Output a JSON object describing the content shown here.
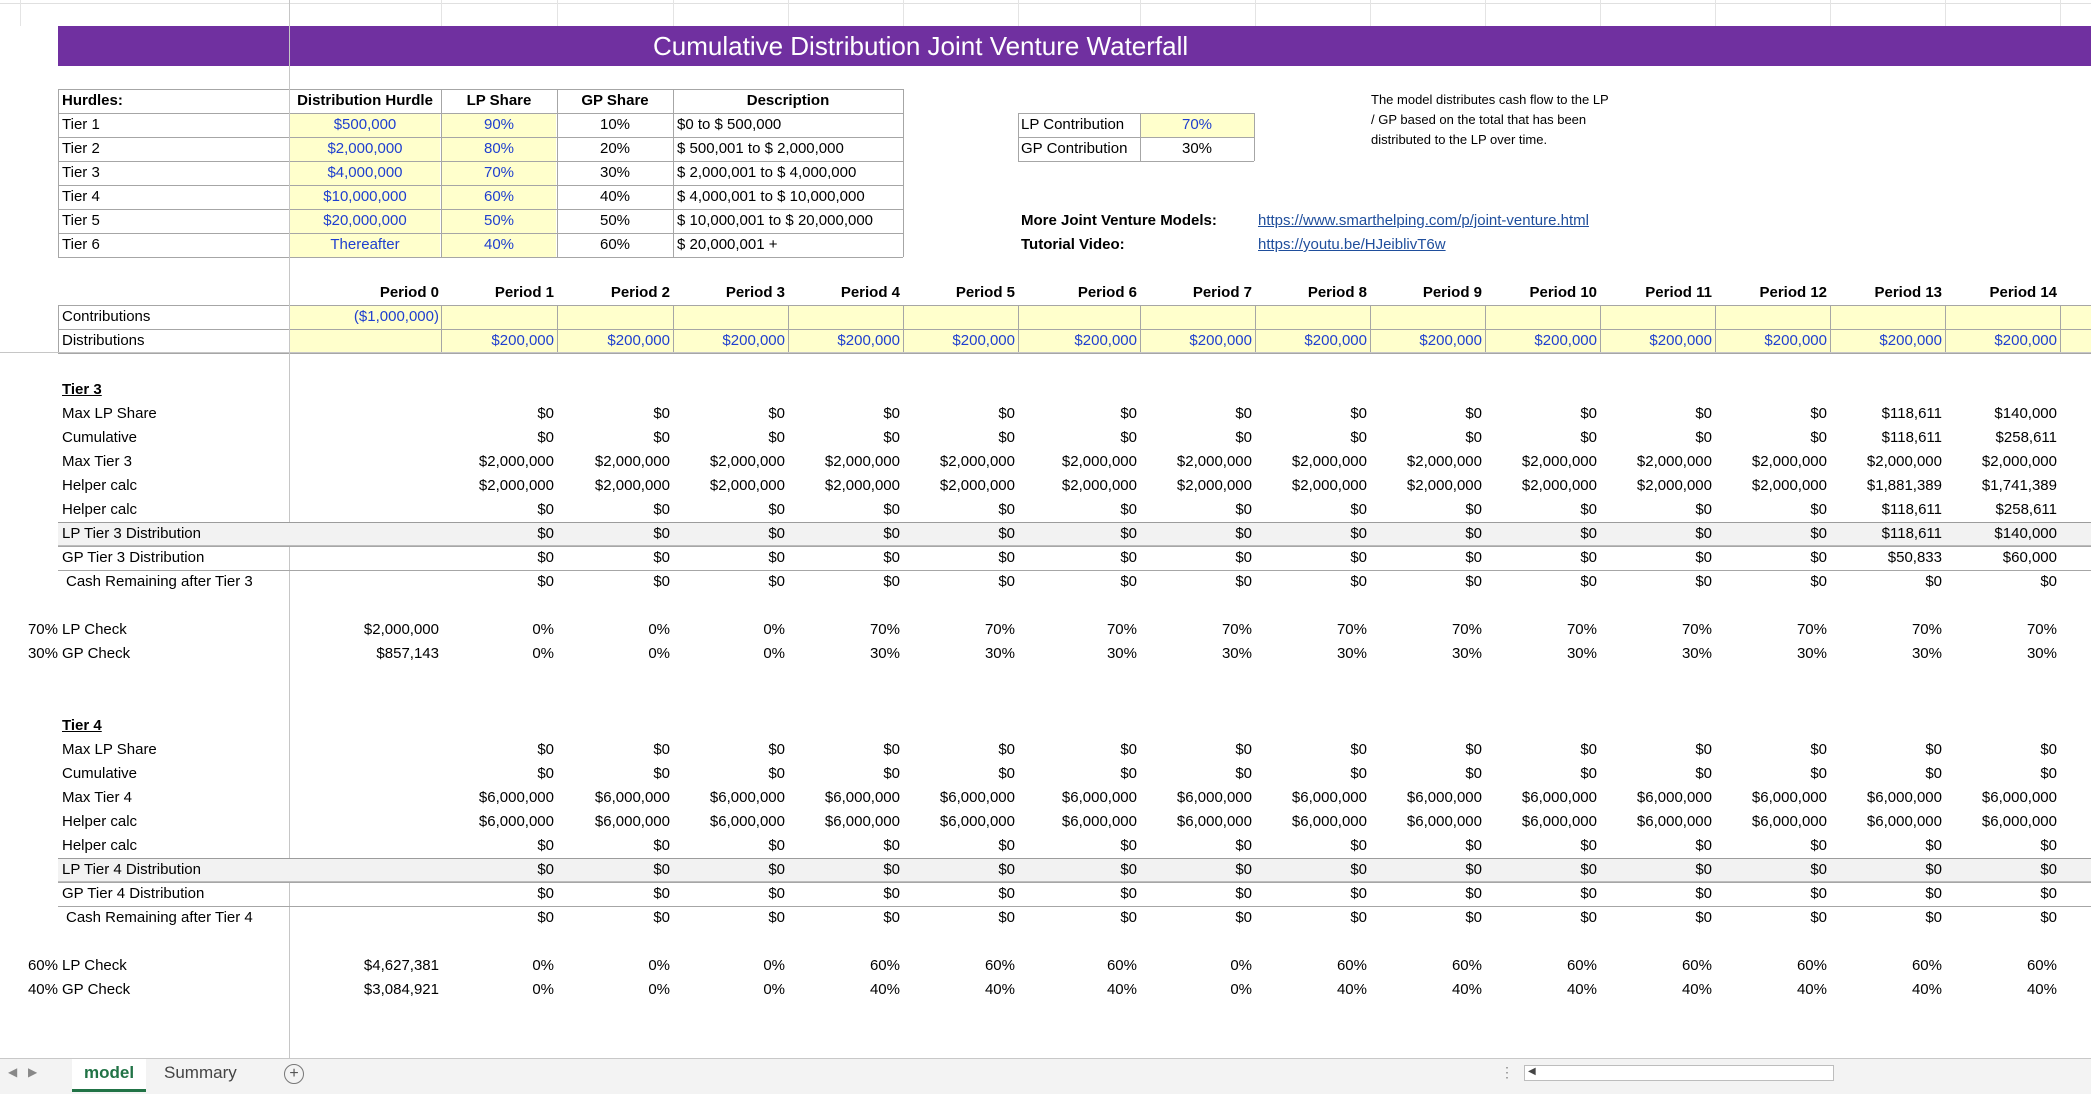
{
  "title": "Cumulative Distribution Joint Venture Waterfall",
  "hurdles": {
    "headers": [
      "Hurdles:",
      "Distribution Hurdle",
      "LP Share",
      "GP Share",
      "Description"
    ],
    "rows": [
      {
        "tier": "Tier 1",
        "hurdle": "$500,000",
        "lp": "90%",
        "gp": "10%",
        "desc": "$0 to $ 500,000"
      },
      {
        "tier": "Tier 2",
        "hurdle": "$2,000,000",
        "lp": "80%",
        "gp": "20%",
        "desc": "$ 500,001 to $ 2,000,000"
      },
      {
        "tier": "Tier 3",
        "hurdle": "$4,000,000",
        "lp": "70%",
        "gp": "30%",
        "desc": "$ 2,000,001 to $ 4,000,000"
      },
      {
        "tier": "Tier 4",
        "hurdle": "$10,000,000",
        "lp": "60%",
        "gp": "40%",
        "desc": "$ 4,000,001 to $ 10,000,000"
      },
      {
        "tier": "Tier 5",
        "hurdle": "$20,000,000",
        "lp": "50%",
        "gp": "50%",
        "desc": "$ 10,000,001 to $ 20,000,000"
      },
      {
        "tier": "Tier 6",
        "hurdle": "Thereafter",
        "lp": "40%",
        "gp": "60%",
        "desc": "$ 20,000,001 +"
      }
    ]
  },
  "contributions_box": [
    {
      "label": "LP Contribution",
      "value": "70%"
    },
    {
      "label": "GP Contribution",
      "value": "30%"
    }
  ],
  "note": "The model distributes cash flow to the LP / GP based on the total that has been distributed to the LP over time.",
  "links": [
    {
      "label": "More Joint Venture Models:",
      "url": "https://www.smarthelping.com/p/joint-venture.html"
    },
    {
      "label": "Tutorial Video:",
      "url": "https://youtu.be/HJeiblivT6w"
    }
  ],
  "periods": [
    "Period 0",
    "Period 1",
    "Period 2",
    "Period 3",
    "Period 4",
    "Period 5",
    "Period 6",
    "Period 7",
    "Period 8",
    "Period 9",
    "Period 10",
    "Period 11",
    "Period 12",
    "Period 13",
    "Period 14"
  ],
  "cashflows": {
    "contributions_label": "Contributions",
    "contributions_p0": "($1,000,000)",
    "distributions_label": "Distributions",
    "distributions": [
      "$200,000",
      "$200,000",
      "$200,000",
      "$200,000",
      "$200,000",
      "$200,000",
      "$200,000",
      "$200,000",
      "$200,000",
      "$200,000",
      "$200,000",
      "$200,000",
      "$200,000",
      "$200,000"
    ]
  },
  "tier3": {
    "header": "Tier 3",
    "rows": [
      {
        "label": "Max LP Share",
        "values": [
          "$0",
          "$0",
          "$0",
          "$0",
          "$0",
          "$0",
          "$0",
          "$0",
          "$0",
          "$0",
          "$0",
          "$0",
          "$118,611",
          "$140,000"
        ]
      },
      {
        "label": "Cumulative",
        "values": [
          "$0",
          "$0",
          "$0",
          "$0",
          "$0",
          "$0",
          "$0",
          "$0",
          "$0",
          "$0",
          "$0",
          "$0",
          "$118,611",
          "$258,611"
        ]
      },
      {
        "label": "Max Tier 3",
        "values": [
          "$2,000,000",
          "$2,000,000",
          "$2,000,000",
          "$2,000,000",
          "$2,000,000",
          "$2,000,000",
          "$2,000,000",
          "$2,000,000",
          "$2,000,000",
          "$2,000,000",
          "$2,000,000",
          "$2,000,000",
          "$2,000,000",
          "$2,000,000"
        ]
      },
      {
        "label": "Helper calc",
        "values": [
          "$2,000,000",
          "$2,000,000",
          "$2,000,000",
          "$2,000,000",
          "$2,000,000",
          "$2,000,000",
          "$2,000,000",
          "$2,000,000",
          "$2,000,000",
          "$2,000,000",
          "$2,000,000",
          "$2,000,000",
          "$1,881,389",
          "$1,741,389"
        ]
      },
      {
        "label": "Helper calc",
        "values": [
          "$0",
          "$0",
          "$0",
          "$0",
          "$0",
          "$0",
          "$0",
          "$0",
          "$0",
          "$0",
          "$0",
          "$0",
          "$118,611",
          "$258,611"
        ]
      },
      {
        "label": "LP Tier 3 Distribution",
        "values": [
          "$0",
          "$0",
          "$0",
          "$0",
          "$0",
          "$0",
          "$0",
          "$0",
          "$0",
          "$0",
          "$0",
          "$0",
          "$118,611",
          "$140,000"
        ]
      },
      {
        "label": "GP Tier 3 Distribution",
        "values": [
          "$0",
          "$0",
          "$0",
          "$0",
          "$0",
          "$0",
          "$0",
          "$0",
          "$0",
          "$0",
          "$0",
          "$0",
          "$50,833",
          "$60,000"
        ]
      },
      {
        "label": "Cash Remaining after Tier 3",
        "values": [
          "$0",
          "$0",
          "$0",
          "$0",
          "$0",
          "$0",
          "$0",
          "$0",
          "$0",
          "$0",
          "$0",
          "$0",
          "$0",
          "$0"
        ]
      }
    ],
    "checks": [
      {
        "pct": "70%",
        "label": "LP Check",
        "p0": "$2,000,000",
        "values": [
          "0%",
          "0%",
          "0%",
          "70%",
          "70%",
          "70%",
          "70%",
          "70%",
          "70%",
          "70%",
          "70%",
          "70%",
          "70%",
          "70%"
        ]
      },
      {
        "pct": "30%",
        "label": "GP Check",
        "p0": "$857,143",
        "values": [
          "0%",
          "0%",
          "0%",
          "30%",
          "30%",
          "30%",
          "30%",
          "30%",
          "30%",
          "30%",
          "30%",
          "30%",
          "30%",
          "30%"
        ]
      }
    ]
  },
  "tier4": {
    "header": "Tier 4",
    "rows": [
      {
        "label": "Max LP Share",
        "values": [
          "$0",
          "$0",
          "$0",
          "$0",
          "$0",
          "$0",
          "$0",
          "$0",
          "$0",
          "$0",
          "$0",
          "$0",
          "$0",
          "$0"
        ]
      },
      {
        "label": "Cumulative",
        "values": [
          "$0",
          "$0",
          "$0",
          "$0",
          "$0",
          "$0",
          "$0",
          "$0",
          "$0",
          "$0",
          "$0",
          "$0",
          "$0",
          "$0"
        ]
      },
      {
        "label": "Max Tier 4",
        "values": [
          "$6,000,000",
          "$6,000,000",
          "$6,000,000",
          "$6,000,000",
          "$6,000,000",
          "$6,000,000",
          "$6,000,000",
          "$6,000,000",
          "$6,000,000",
          "$6,000,000",
          "$6,000,000",
          "$6,000,000",
          "$6,000,000",
          "$6,000,000"
        ]
      },
      {
        "label": "Helper calc",
        "values": [
          "$6,000,000",
          "$6,000,000",
          "$6,000,000",
          "$6,000,000",
          "$6,000,000",
          "$6,000,000",
          "$6,000,000",
          "$6,000,000",
          "$6,000,000",
          "$6,000,000",
          "$6,000,000",
          "$6,000,000",
          "$6,000,000",
          "$6,000,000"
        ]
      },
      {
        "label": "Helper calc",
        "values": [
          "$0",
          "$0",
          "$0",
          "$0",
          "$0",
          "$0",
          "$0",
          "$0",
          "$0",
          "$0",
          "$0",
          "$0",
          "$0",
          "$0"
        ]
      },
      {
        "label": "LP Tier 4 Distribution",
        "values": [
          "$0",
          "$0",
          "$0",
          "$0",
          "$0",
          "$0",
          "$0",
          "$0",
          "$0",
          "$0",
          "$0",
          "$0",
          "$0",
          "$0"
        ]
      },
      {
        "label": "GP Tier 4 Distribution",
        "values": [
          "$0",
          "$0",
          "$0",
          "$0",
          "$0",
          "$0",
          "$0",
          "$0",
          "$0",
          "$0",
          "$0",
          "$0",
          "$0",
          "$0"
        ]
      },
      {
        "label": "Cash Remaining after Tier 4",
        "values": [
          "$0",
          "$0",
          "$0",
          "$0",
          "$0",
          "$0",
          "$0",
          "$0",
          "$0",
          "$0",
          "$0",
          "$0",
          "$0",
          "$0"
        ]
      }
    ],
    "checks": [
      {
        "pct": "60%",
        "label": "LP Check",
        "p0": "$4,627,381",
        "values": [
          "0%",
          "0%",
          "0%",
          "60%",
          "60%",
          "60%",
          "0%",
          "60%",
          "60%",
          "60%",
          "60%",
          "60%",
          "60%",
          "60%"
        ]
      },
      {
        "pct": "40%",
        "label": "GP Check",
        "p0": "$3,084,921",
        "values": [
          "0%",
          "0%",
          "0%",
          "40%",
          "40%",
          "40%",
          "0%",
          "40%",
          "40%",
          "40%",
          "40%",
          "40%",
          "40%",
          "40%"
        ]
      }
    ]
  },
  "sheet_tabs": [
    {
      "label": "model",
      "active": true
    },
    {
      "label": "Summary",
      "active": false
    }
  ],
  "colors": {
    "title_bg": "#7030a0",
    "input_fill": "#ffffcc",
    "input_text": "#1f3fcf",
    "active_tab": "#217346"
  }
}
